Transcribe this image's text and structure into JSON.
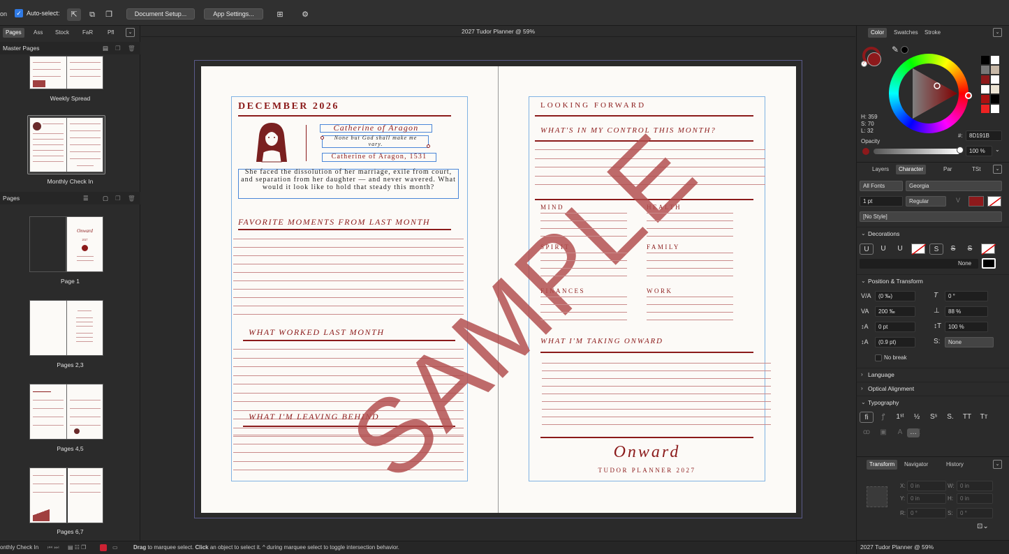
{
  "toolbar": {
    "partial_left": "on",
    "autoselect_label": "Auto-select:",
    "document_setup": "Document Setup...",
    "app_settings": "App Settings..."
  },
  "left_panel": {
    "tabs": [
      "Pages",
      "Ass",
      "Stock",
      "FaR",
      "Pfl"
    ],
    "master_pages_title": "Master Pages",
    "master_pages": [
      "Weekly Spread",
      "Monthly Check In"
    ],
    "pages_title": "Pages",
    "pages": [
      "Page 1",
      "Pages 2,3",
      "Pages 4,5",
      "Pages 6,7"
    ],
    "page1_thumb": {
      "title": "Onward",
      "year": "2027"
    }
  },
  "document": {
    "title": "2027 Tudor Planner @ 59%",
    "left_page": {
      "month": "DECEMBER 2026",
      "queen_name": "Catherine of Aragon",
      "quote": "None but God shall make me vary.",
      "attribution": "Catherine of Aragon, 1531",
      "reflection": "She faced the dissolution of her marriage, exile from court, and separation from her daughter — and never wavered. What would it look like to hold that steady this month?",
      "section1": "FAVORITE MOMENTS FROM LAST MONTH",
      "section2": "WHAT WORKED LAST MONTH",
      "section3": "WHAT I'M LEAVING BEHIND"
    },
    "right_page": {
      "heading": "LOOKING FORWARD",
      "control": "WHAT'S IN MY CONTROL THIS MONTH?",
      "areas": [
        "MIND",
        "HEALTH",
        "SPIRIT",
        "FAMILY",
        "FINANCES",
        "WORK"
      ],
      "onward_heading": "WHAT I'M TAKING ONWARD",
      "footer_title": "Onward",
      "footer_sub": "TUDOR PLANNER 2027"
    },
    "watermark": "SAMPLE"
  },
  "right_panel": {
    "color_tabs": [
      "Color",
      "Swatches",
      "Stroke"
    ],
    "hsl": {
      "h": "H: 359",
      "s": "S: 70",
      "l": "L: 32"
    },
    "hex_label": "#:",
    "hex_value": "8D191B",
    "opacity_label": "Opacity",
    "opacity_value": "100 %",
    "char_tabs": [
      "Layers",
      "Character",
      "Par",
      "TSt"
    ],
    "font_collection": "All Fonts",
    "font_family": "Georgia",
    "font_size": "1 pt",
    "font_style": "Regular",
    "style": "[No Style]",
    "decorations_title": "Decorations",
    "decoration_none": "None",
    "position_title": "Position & Transform",
    "kerning": "(0 ‰)",
    "tracking": "200 ‰",
    "baseline": "0 pt",
    "leading": "(0.9 pt)",
    "shear": "0 °",
    "vscale": "88 %",
    "hscale": "100 %",
    "caps": "None",
    "no_break": "No break",
    "language_title": "Language",
    "optical_title": "Optical Alignment",
    "typography_title": "Typography",
    "transform_tabs": [
      "Transform",
      "Navigator",
      "History"
    ],
    "transform": {
      "x": "0 in",
      "y": "0 in",
      "w": "0 in",
      "h": "0 in",
      "r": "0 °",
      "s": "0 °"
    },
    "transform_labels": {
      "x": "X:",
      "y": "Y:",
      "w": "W:",
      "h": "H:",
      "r": "R:",
      "s": "S:"
    },
    "footer_title": "2027 Tudor Planner @ 59%",
    "primary_color": "#8d191b"
  },
  "status": {
    "left_label": "onthly Check In",
    "hint_drag": "Drag",
    "hint_1": " to marquee select. ",
    "hint_click": "Click",
    "hint_2": " an object to select it. ^ during marquee select to toggle intersection behavior."
  }
}
